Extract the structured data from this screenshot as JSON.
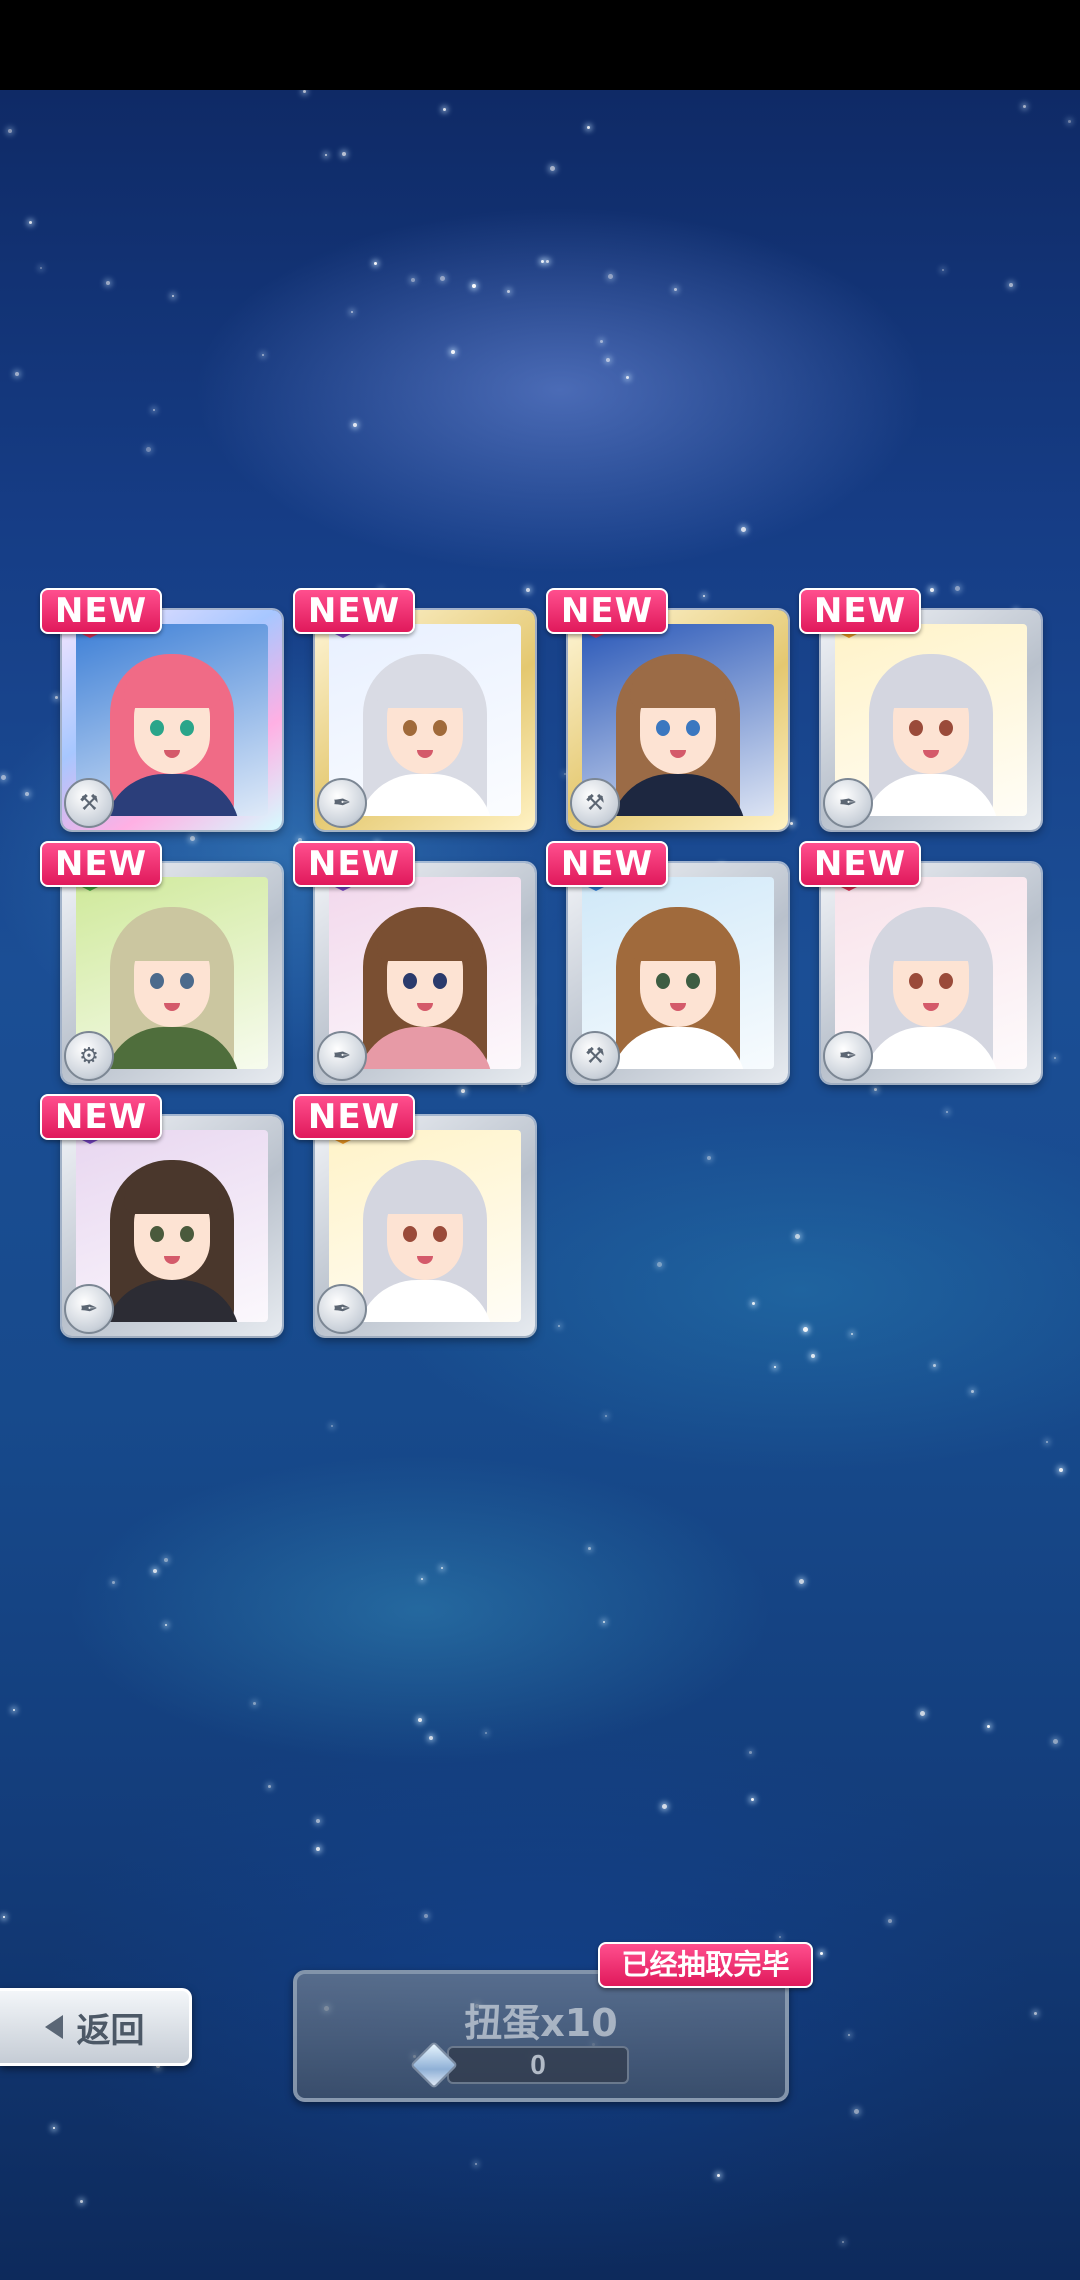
{
  "results": {
    "badge_label": "NEW",
    "cards": [
      {
        "name": "card-1",
        "frame": "srare",
        "attribute_color": "#e22d55",
        "tool_icon": "hammer-icon",
        "hair": "#f06b86",
        "eye": "#2aa58a",
        "bg": "#3d7fd6",
        "outfit": "#2b3e7a"
      },
      {
        "name": "card-2",
        "frame": "rare",
        "attribute_color": "#7a45c8",
        "tool_icon": "feather-icon",
        "hair": "#d9dbe4",
        "eye": "#a06a3a",
        "bg": "#e8f0ff",
        "outfit": "#ffffff"
      },
      {
        "name": "card-3",
        "frame": "rare",
        "attribute_color": "#e22d55",
        "tool_icon": "hammer-icon",
        "hair": "#9b6b46",
        "eye": "#3a77c0",
        "bg": "#2a58b8",
        "outfit": "#1d2740"
      },
      {
        "name": "card-4",
        "frame": "normal",
        "attribute_color": "#f09a24",
        "tool_icon": "feather-icon",
        "hair": "#d4d6e0",
        "eye": "#9a4b3a",
        "bg": "#fff3c8",
        "outfit": "#ffffff"
      },
      {
        "name": "card-5",
        "frame": "normal",
        "attribute_color": "#44a83c",
        "tool_icon": "wrench-icon",
        "hair": "#cbc6a0",
        "eye": "#4b6a8c",
        "bg": "#cfe99a",
        "outfit": "#4f6e3c"
      },
      {
        "name": "card-6",
        "frame": "normal",
        "attribute_color": "#7a45c8",
        "tool_icon": "feather-icon",
        "hair": "#7a4f32",
        "eye": "#2a3a6c",
        "bg": "#f2d8ec",
        "outfit": "#e79aa6"
      },
      {
        "name": "card-7",
        "frame": "normal",
        "attribute_color": "#2d7ed8",
        "tool_icon": "hammer-icon",
        "hair": "#a06a3c",
        "eye": "#3d5d42",
        "bg": "#cfe8f8",
        "outfit": "#ffffff"
      },
      {
        "name": "card-8",
        "frame": "normal",
        "attribute_color": "#e22d55",
        "tool_icon": "feather-icon",
        "hair": "#d4d6e0",
        "eye": "#9a4b3a",
        "bg": "#f8e2ea",
        "outfit": "#ffffff"
      },
      {
        "name": "card-9",
        "frame": "normal",
        "attribute_color": "#7a45c8",
        "tool_icon": "feather-icon",
        "hair": "#4a372c",
        "eye": "#4a5a3c",
        "bg": "#e8d6f0",
        "outfit": "#2c2c34"
      },
      {
        "name": "card-10",
        "frame": "normal",
        "attribute_color": "#f09a24",
        "tool_icon": "feather-icon",
        "hair": "#d4d6e0",
        "eye": "#9a4b3a",
        "bg": "#fff3c8",
        "outfit": "#ffffff"
      }
    ]
  },
  "footer": {
    "back_label": "返回",
    "gacha_label": "扭蛋x10",
    "gacha_cost": "0",
    "cost_icon": "gem-icon",
    "completed_label": "已经抽取完毕"
  },
  "colors": {
    "badge": "#e0195b",
    "background": "#1b4e95"
  }
}
